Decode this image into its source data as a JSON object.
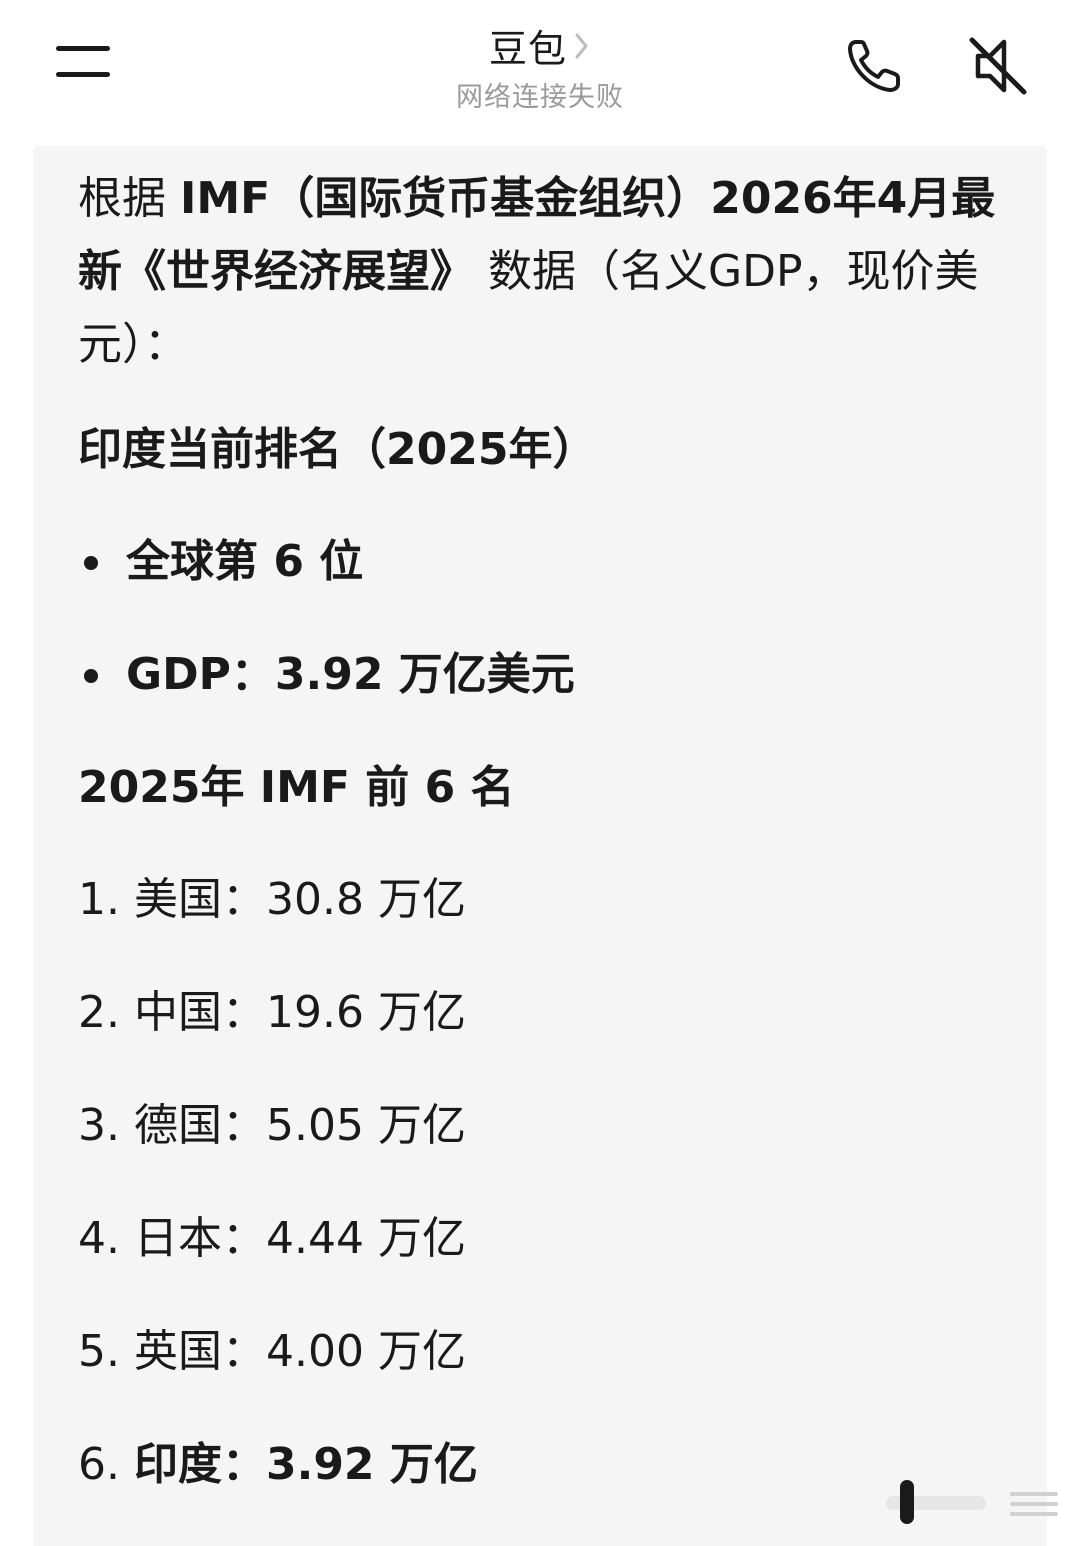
{
  "header": {
    "title": "豆包",
    "subtitle": "网络连接失败"
  },
  "message": {
    "intro_prefix": "根据 ",
    "intro_bold": "IMF（国际货币基金组织）2026年4月最新《世界经济展望》",
    "intro_suffix": " 数据（名义GDP，现价美元）：",
    "india_heading": "印度当前排名（2025年）",
    "india_bullets": [
      "全球第 6 位",
      "GDP：3.92 万亿美元"
    ],
    "top_heading": "2025年 IMF 前 6 名",
    "rankings": [
      {
        "num": "1.",
        "country": "美国：",
        "value": "30.8 万亿"
      },
      {
        "num": "2.",
        "country": "中国：",
        "value": "19.6 万亿"
      },
      {
        "num": "3.",
        "country": "德国：",
        "value": "5.05 万亿"
      },
      {
        "num": "4.",
        "country": "日本：",
        "value": "4.44 万亿"
      },
      {
        "num": "5.",
        "country": "英国：",
        "value": "4.00 万亿"
      },
      {
        "num": "6.",
        "country": "印度：",
        "value": "3.92 万亿"
      }
    ]
  },
  "icons": {
    "menu": "menu-icon",
    "title_chevron": "chevron-right-icon",
    "call": "phone-icon",
    "mute": "speaker-muted-icon",
    "scroll": "scroll-indicator-icon"
  },
  "colors": {
    "text": "#1a1a1a",
    "subtitle": "#9a9a9a",
    "bubble": "#f5f5f5",
    "background": "#ffffff"
  }
}
